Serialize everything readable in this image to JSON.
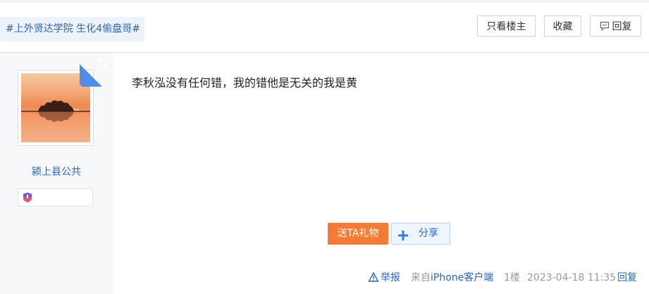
{
  "header": {
    "topic_tag": "#上外贤达学院 生化4偷盘哥#",
    "only_op_label": "只看楼主",
    "favorite_label": "收藏",
    "reply_label": "回复"
  },
  "author": {
    "username": "颍上县公共",
    "op_badge": "楼主",
    "avatar_icon": "sunset-lake-avatar",
    "level_icon": "level-badge-icon"
  },
  "post": {
    "content": "李秋泓没有任何错，我的错他是无关的我是黄"
  },
  "actions": {
    "gift_label": "送TA礼物",
    "share_label": "分享"
  },
  "footer": {
    "report_label": "举报",
    "source_prefix": "来自",
    "source_client": "iPhone客户端",
    "floor": "1楼",
    "timestamp": "2023-04-18 11:35",
    "reply_label": "回复"
  },
  "colors": {
    "link_blue": "#2d64b3",
    "gift_orange": "#f47b35",
    "op_ribbon": "#4f8ee8"
  }
}
